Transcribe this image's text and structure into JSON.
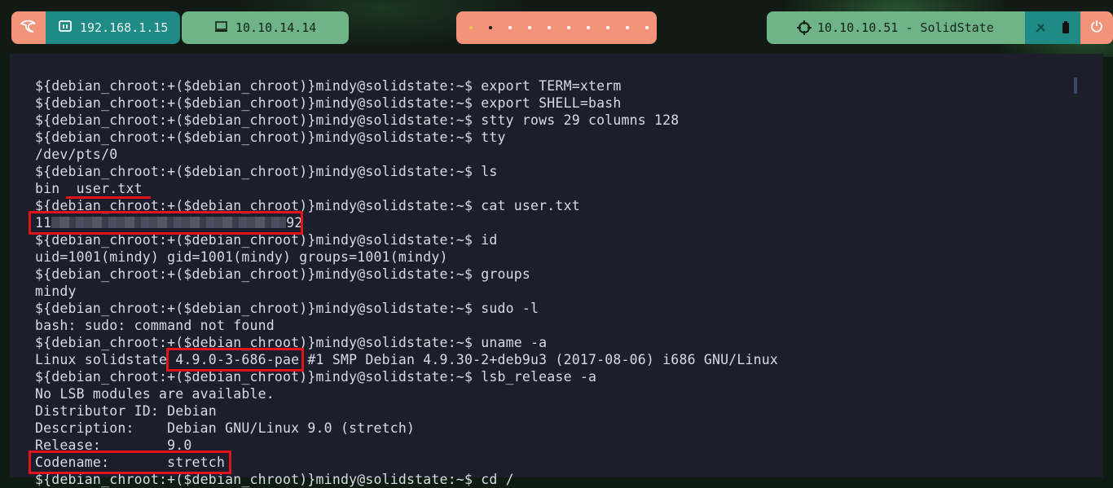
{
  "topbar": {
    "logo_icon": "kali-dragon-icon",
    "local_ip": "192.168.1.15",
    "local_ip_icon": "network-icon",
    "vpn_ip": "10.10.14.14",
    "vpn_ip_icon": "monitor-icon",
    "workspaces_count": 10,
    "target_label": "10.10.10.51 - SolidState",
    "target_icon": "crosshair-icon",
    "status_icons": [
      "settings-icon",
      "battery-icon"
    ],
    "power_icon": "power-icon",
    "colors": {
      "salmon": "#f2937a",
      "teal": "#1f8a86",
      "green": "#6fb487"
    }
  },
  "terminal": {
    "background": "#1c1f2b",
    "lines": [
      "${debian_chroot:+($debian_chroot)}mindy@solidstate:~$ export TERM=xterm",
      "${debian_chroot:+($debian_chroot)}mindy@solidstate:~$ export SHELL=bash",
      "${debian_chroot:+($debian_chroot)}mindy@solidstate:~$ stty rows 29 columns 128",
      "${debian_chroot:+($debian_chroot)}mindy@solidstate:~$ tty",
      "/dev/pts/0",
      "${debian_chroot:+($debian_chroot)}mindy@solidstate:~$ ls",
      "bin  user.txt",
      "${debian_chroot:+($debian_chroot)}mindy@solidstate:~$ cat user.txt",
      "",
      "${debian_chroot:+($debian_chroot)}mindy@solidstate:~$ id",
      "uid=1001(mindy) gid=1001(mindy) groups=1001(mindy)",
      "${debian_chroot:+($debian_chroot)}mindy@solidstate:~$ groups",
      "mindy",
      "${debian_chroot:+($debian_chroot)}mindy@solidstate:~$ sudo -l",
      "bash: sudo: command not found",
      "${debian_chroot:+($debian_chroot)}mindy@solidstate:~$ uname -a",
      "Linux solidstate 4.9.0-3-686-pae #1 SMP Debian 4.9.30-2+deb9u3 (2017-08-06) i686 GNU/Linux",
      "${debian_chroot:+($debian_chroot)}mindy@solidstate:~$ lsb_release -a",
      "No LSB modules are available.",
      "Distributor ID: Debian",
      "Description:    Debian GNU/Linux 9.0 (stretch)",
      "Release:        9.0",
      "Codename:       stretch",
      "${debian_chroot:+($debian_chroot)}mindy@solidstate:~$ cd /"
    ],
    "flag_prefix": "11",
    "flag_suffix": "92",
    "highlight_color": "#e0141b"
  }
}
